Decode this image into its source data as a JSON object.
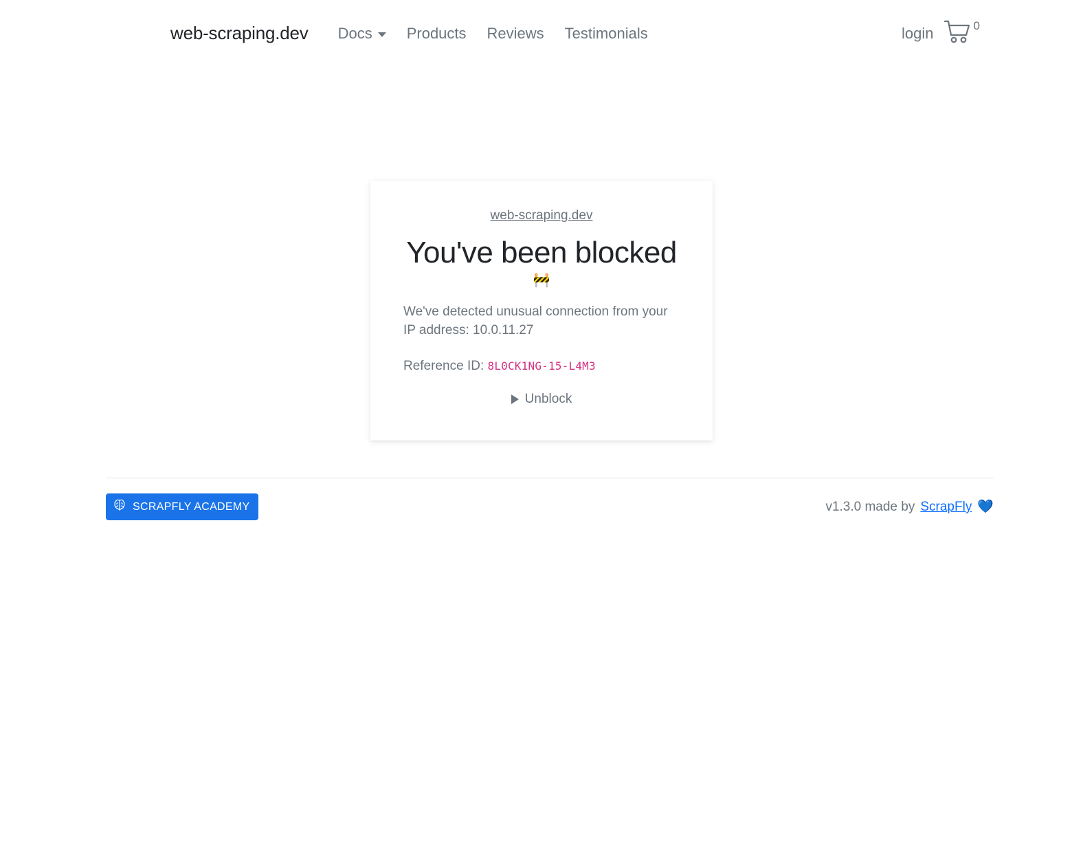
{
  "navbar": {
    "brand": "web-scraping.dev",
    "items": [
      {
        "label": "Docs",
        "has_caret": true
      },
      {
        "label": "Products",
        "has_caret": false
      },
      {
        "label": "Reviews",
        "has_caret": false
      },
      {
        "label": "Testimonials",
        "has_caret": false
      }
    ],
    "login_label": "login",
    "cart_icon": "shopping-cart-icon",
    "cart_count": "0"
  },
  "card": {
    "site_link": "web-scraping.dev",
    "title": "You've been blocked",
    "barrier_emoji": "🚧",
    "message": "We've detected unusual connection from your IP address: 10.0.11.27",
    "reference_label": "Reference ID:",
    "reference_id": "8L0CK1NG-15-L4M3",
    "unblock_label": "Unblock"
  },
  "footer": {
    "academy_badge_label": "SCRAPFLY ACADEMY",
    "academy_icon": "brain-icon",
    "version_text": "v1.3.0 made by",
    "credit_link": "ScrapFly",
    "heart_emoji": "💙"
  },
  "colors": {
    "brand_blue": "#1a73e8",
    "link_blue": "#0d6efd",
    "muted_gray": "#6c757d",
    "code_pink": "#d63384",
    "heading_dark": "#212529"
  }
}
